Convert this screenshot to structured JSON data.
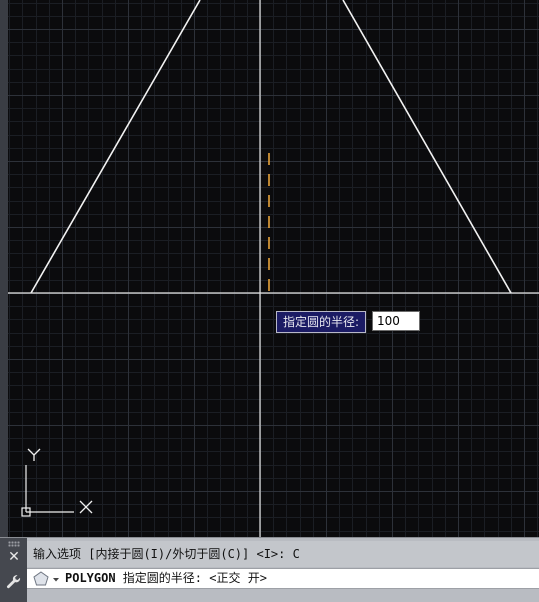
{
  "colors": {
    "canvas_background": "#0b0b0d",
    "grid_minor": "#1b1e24",
    "grid_major": "#2d3139",
    "geometry_line": "#ffffff",
    "crosshair": "#e6e6e6",
    "tracking_dash": "#e7a33a",
    "prompt_background": "#1b1b64"
  },
  "canvas": {
    "ucs_icon": {
      "x_label": "X",
      "y_label": "Y"
    }
  },
  "dynamic_input": {
    "prompt": "指定圆的半径:",
    "value": "100"
  },
  "command_line": {
    "history": "输入选项 [内接于圆(I)/外切于圆(C)] <I>: C",
    "command_name": "POLYGON",
    "command_prompt": " 指定圆的半径: <正交 开>",
    "close_icon": "close-icon",
    "customize_icon": "wrench-icon",
    "recent_commands_icon": "pentagon-icon"
  }
}
